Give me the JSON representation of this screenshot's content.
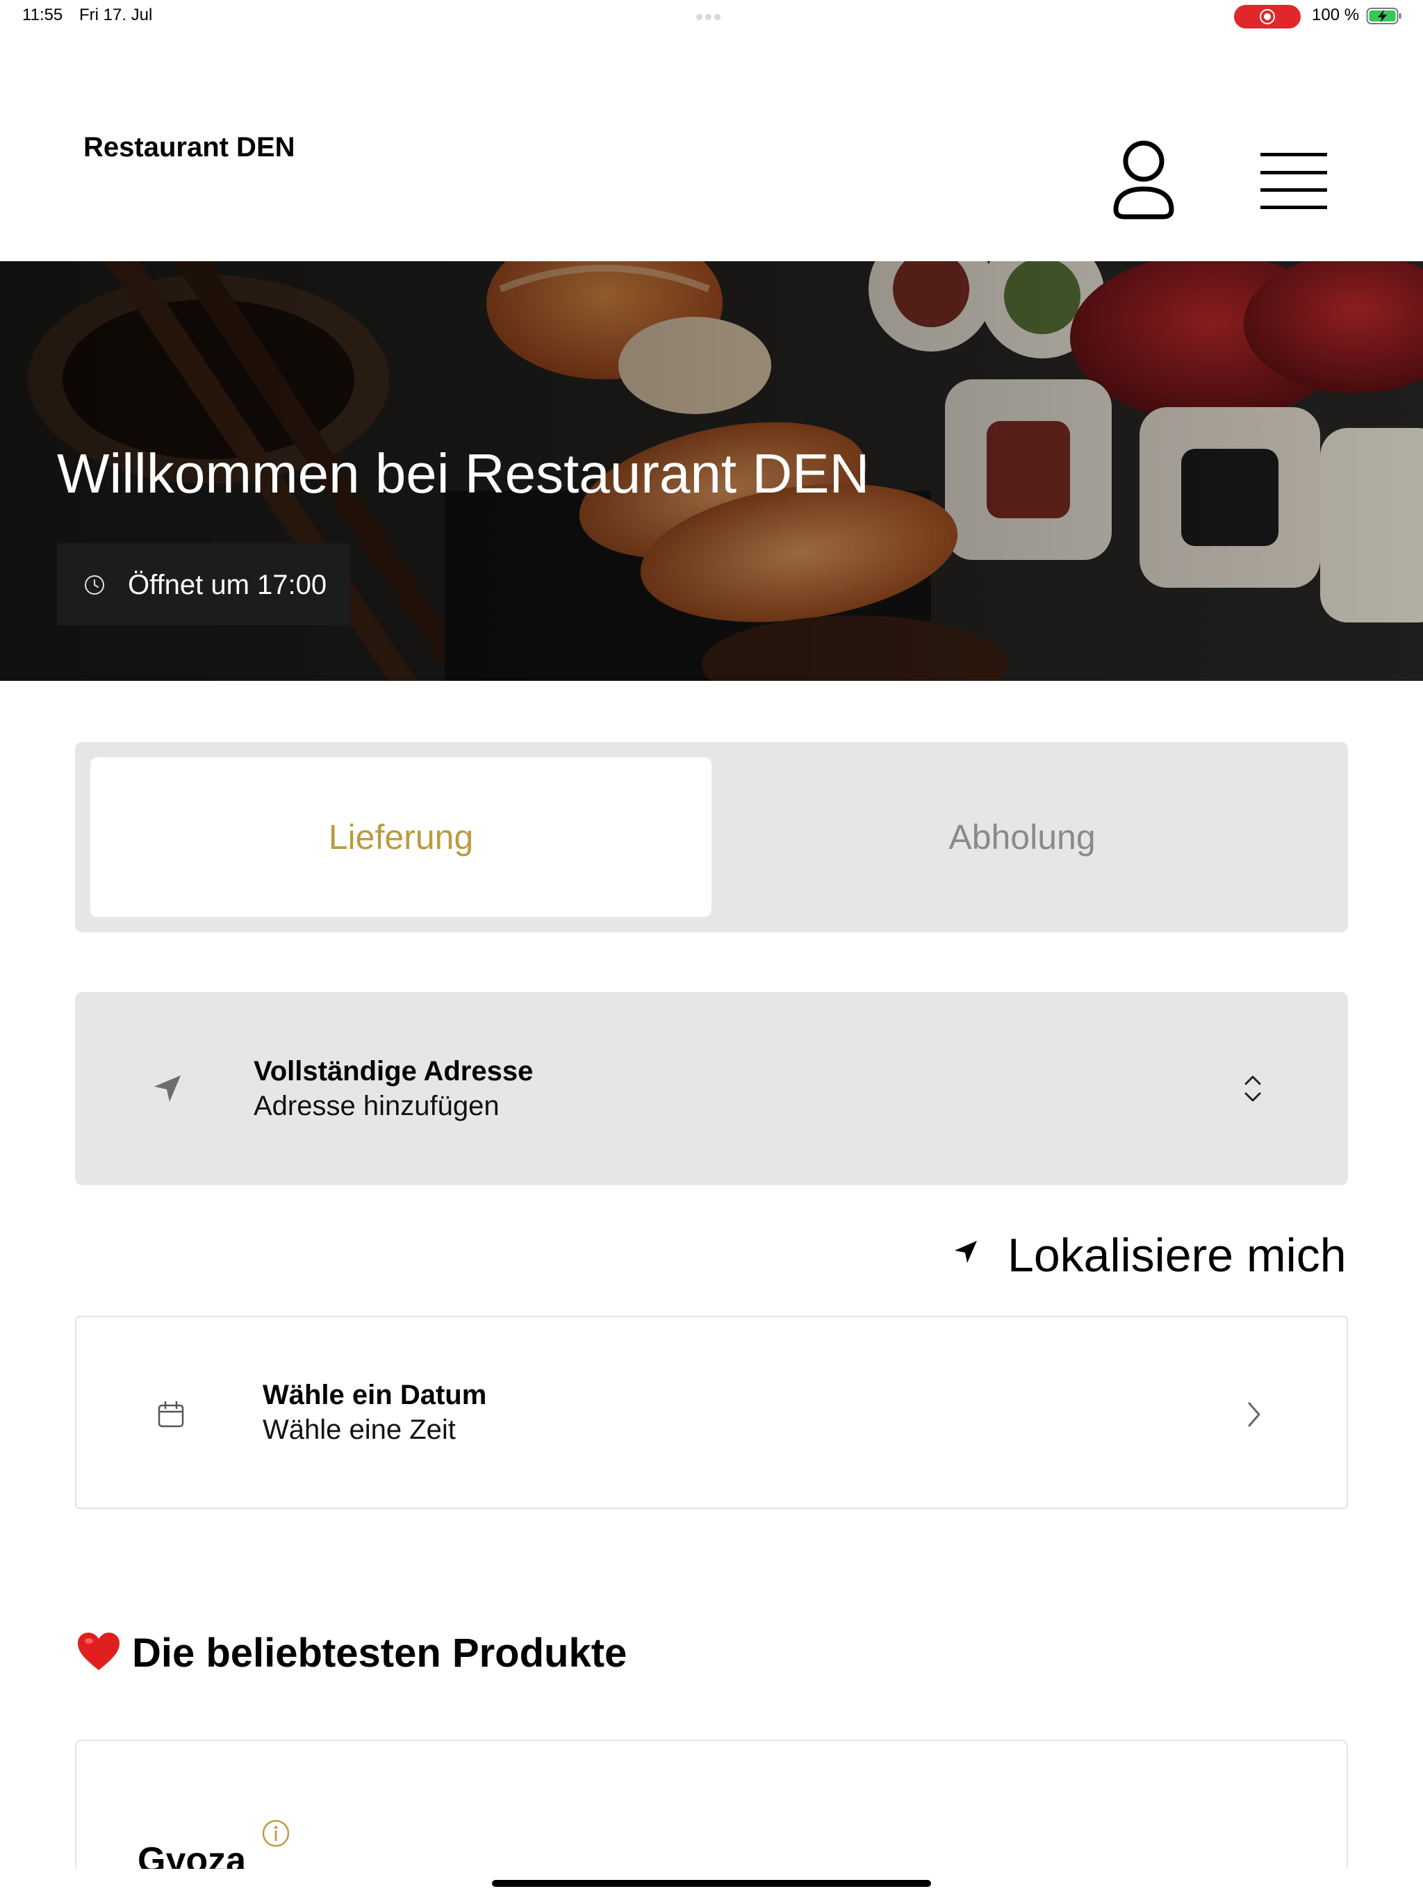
{
  "status_bar": {
    "time": "11:55",
    "date": "Fri 17. Jul",
    "battery": "100 %",
    "record_color": "#e0282c",
    "battery_color": "#34c759"
  },
  "header": {
    "brand": "Restaurant DEN",
    "user_icon": "person-outline-icon",
    "menu_icon": "hamburger-menu-icon"
  },
  "hero": {
    "title": "Willkommen bei Restaurant DEN",
    "hours": "Öffnet um 17:00",
    "hours_icon": "clock-icon"
  },
  "order_mode": {
    "tabs": [
      {
        "label": "Lieferung",
        "active": true
      },
      {
        "label": "Abholung",
        "active": false
      }
    ],
    "accent_color": "#bb9c3f"
  },
  "address": {
    "title": "Vollständige Adresse",
    "placeholder": "Adresse hinzufügen",
    "icon": "location-arrow-icon",
    "toggle_icon": "chevron-up-down-icon"
  },
  "locate": {
    "label": "Lokalisiere mich",
    "icon": "location-arrow-icon"
  },
  "schedule": {
    "title": "Wähle ein Datum",
    "subtitle": "Wähle eine Zeit",
    "icon": "calendar-icon",
    "chevron_icon": "chevron-right-icon"
  },
  "popular": {
    "emoji": "❤️",
    "title": "Die beliebtesten Produkte",
    "products": [
      {
        "name": "Gyoza",
        "info_icon": "info-icon"
      }
    ]
  }
}
